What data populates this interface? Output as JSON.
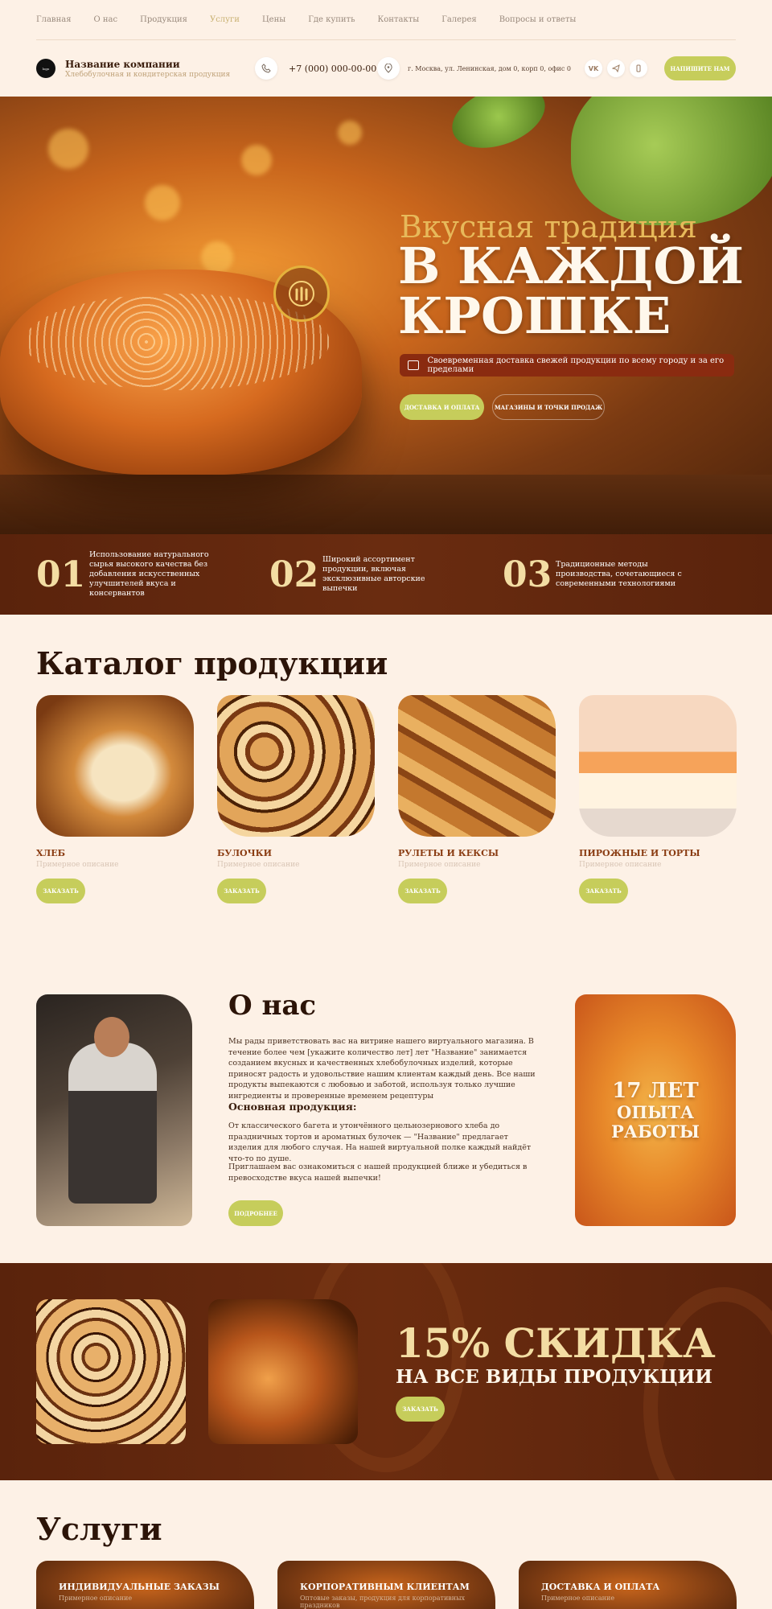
{
  "nav": {
    "items": [
      {
        "label": "Главная",
        "active": false
      },
      {
        "label": "О нас",
        "active": false
      },
      {
        "label": "Продукция",
        "active": false
      },
      {
        "label": "Услуги",
        "active": true
      },
      {
        "label": "Цены",
        "active": false
      },
      {
        "label": "Где купить",
        "active": false
      },
      {
        "label": "Контакты",
        "active": false
      },
      {
        "label": "Галерея",
        "active": false
      },
      {
        "label": "Вопросы и ответы",
        "active": false
      }
    ]
  },
  "header": {
    "logo_text": "logo",
    "company_name": "Название компании",
    "company_sub": "Хлебобулочная и кондитерская продукция",
    "phone": "+7 (000) 000-00-00",
    "address": "г. Москва, ул. Ленинская, дом 0, корп 0, офис 0",
    "social": [
      "VK",
      "TG",
      "▮"
    ],
    "write_label": "НАПИШИТЕ НАМ"
  },
  "hero": {
    "subtitle": "Вкусная традиция",
    "title": "В КАЖДОЙ КРОШКЕ",
    "delivery": "Своевременная доставка свежей продукции по всему городу и за его пределами",
    "btn_primary": "ДОСТАВКА И ОПЛАТА",
    "btn_secondary": "МАГАЗИНЫ И ТОЧКИ ПРОДАЖ"
  },
  "features": [
    {
      "num": "01",
      "text": "Использование натурального сырья высокого качества без добавления искусственных улучшителей вкуса и консервантов"
    },
    {
      "num": "02",
      "text": "Широкий ассортимент продукции, включая эксклюзивные авторские выпечки"
    },
    {
      "num": "03",
      "text": "Традиционные методы производства, сочетающиеся с современными технологиями"
    }
  ],
  "catalog": {
    "title": "Каталог продукции",
    "items": [
      {
        "name": "ХЛЕБ",
        "desc": "Примерное описание",
        "order": "ЗАКАЗАТЬ"
      },
      {
        "name": "БУЛОЧКИ",
        "desc": "Примерное описание",
        "order": "ЗАКАЗАТЬ"
      },
      {
        "name": "РУЛЕТЫ И КЕКСЫ",
        "desc": "Примерное описание",
        "order": "ЗАКАЗАТЬ"
      },
      {
        "name": "ПИРОЖНЫЕ И ТОРТЫ",
        "desc": "Примерное описание",
        "order": "ЗАКАЗАТЬ"
      }
    ]
  },
  "about": {
    "title": "О нас",
    "text1": "Мы рады приветствовать вас на витрине нашего виртуального магазина. В течение более чем [укажите количество лет] лет \"Название\" занимается созданием вкусных и качественных хлебобулочных изделий, которые приносят радость и удовольствие нашим клиентам каждый день. Все наши продукты выпекаются с любовью и заботой, используя только лучшие ингредиенты и проверенные временем рецептуры",
    "subtitle": "Основная продукция:",
    "text2": "От классического багета и утончённого цельнозернового хлеба до праздничных тортов и ароматных булочек — \"Название\" предлагает изделия для любого случая. На нашей виртуальной полке каждый найдёт что-то по душе.",
    "text3": "Приглашаем вас ознакомиться с нашей продукцией ближе и убедиться в превосходстве вкуса нашей выпечки!",
    "more": "ПОДРОБНЕЕ",
    "years_1": "17 ЛЕТ",
    "years_2": "ОПЫТА",
    "years_3": "РАБОТЫ"
  },
  "promo": {
    "title": "15% СКИДКА",
    "subtitle": "НА ВСЕ ВИДЫ ПРОДУКЦИИ",
    "order": "ЗАКАЗАТЬ"
  },
  "services": {
    "title": "Услуги",
    "items": [
      {
        "name": "ИНДИВИДУАЛЬНЫЕ ЗАКАЗЫ",
        "desc": "Примерное описание"
      },
      {
        "name": "КОРПОРАТИВНЫМ КЛИЕНТАМ",
        "desc": "Оптовые заказы, продукция для корпоративных праздников"
      },
      {
        "name": "ДОСТАВКА И ОПЛАТА",
        "desc": "Примерное описание"
      }
    ]
  },
  "colors": {
    "accent_green": "#c6cd5b",
    "dark_brown": "#5a230c",
    "cream": "#fdf1e6",
    "gold": "#f3dda3"
  }
}
